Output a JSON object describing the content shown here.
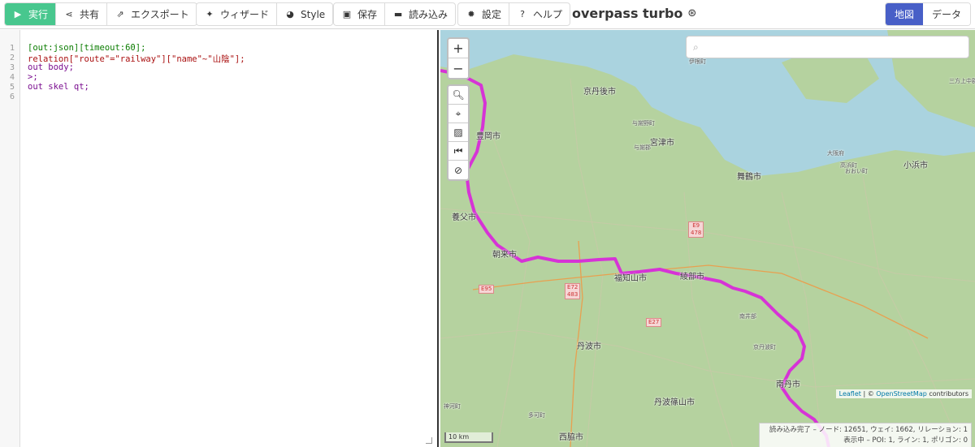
{
  "toolbar": {
    "run": "実行",
    "share": "共有",
    "export": "エクスポート",
    "wizard": "ウィザード",
    "style": "Style",
    "save": "保存",
    "load": "読み込み",
    "settings": "設定",
    "help": "ヘルプ",
    "brand": "overpass turbo",
    "view_map": "地図",
    "view_data": "データ"
  },
  "editor": {
    "lines": [
      "1",
      "2",
      "3",
      "4",
      "5",
      "6"
    ],
    "code": [
      "[out:json][timeout:60];",
      "relation[\"route\"=\"railway\"][\"name\"~\"山陰\"];",
      "out body;",
      ">;",
      "out skel qt;",
      ""
    ]
  },
  "map": {
    "zoom_in": "+",
    "zoom_out": "−",
    "places": {
      "p1": "京丹後市",
      "p2": "豊岡市",
      "p3": "宮津市",
      "p4": "舞鶴市",
      "p5": "小浜市",
      "p6": "養父市",
      "p7": "朝来市",
      "p8": "福知山市",
      "p9": "綾部市",
      "p10": "丹波市",
      "p11": "南丹市",
      "p12": "丹波篠山市",
      "p13": "西脇市",
      "s1": "与謝野町",
      "s2": "大阪府",
      "s3": "高浜町",
      "s4": "おおい町",
      "s5": "南井部",
      "s6": "京丹波町",
      "s7": "神河町",
      "s8": "多可町",
      "s9": "伊根町",
      "s10": "三方上中郡",
      "s11": "与謝郡"
    },
    "shields": {
      "e9": "E9\n478",
      "e72": "E72\n483",
      "e95": "E95",
      "e27": "E27"
    },
    "attribution_leaflet": "Leaflet",
    "attribution_osm": "OpenStreetMap",
    "attribution_rest": "contributors",
    "scale": "10 km",
    "status_line1": "読み込み完了 – ノード: 12651, ウェイ: 1662, リレーション: 1",
    "status_line2": "表示中 – POI: 1, ライン: 1, ポリゴン: 0",
    "route_color": "#d633d6"
  }
}
